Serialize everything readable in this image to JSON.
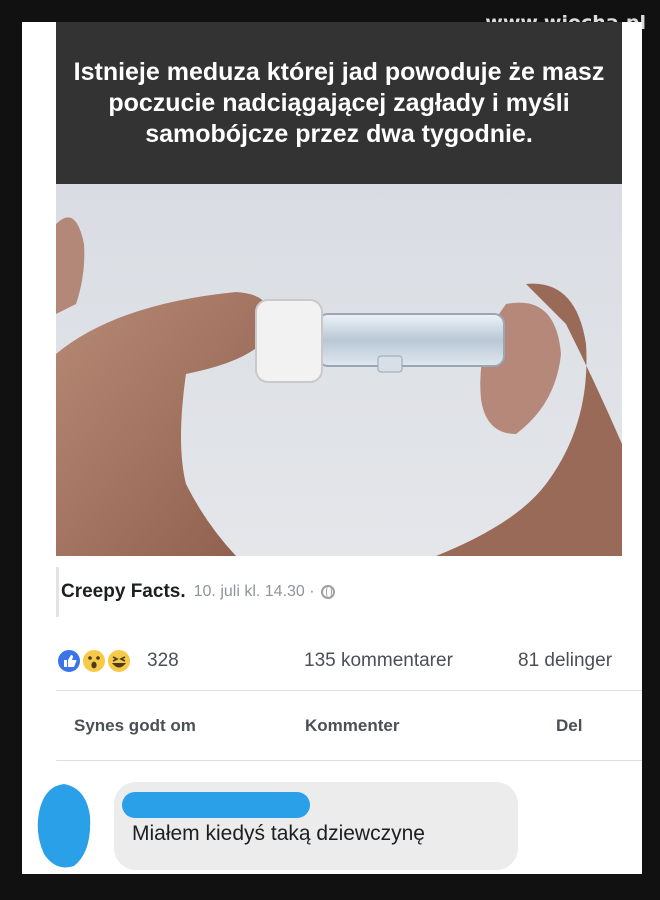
{
  "watermark": "www.wiocha.pl",
  "caption": "Istnieje meduza której jad powoduje że masz poczucie nadciągającej zagłady i myśli samobójcze przez dwa tygodnie.",
  "post": {
    "page_name": "Creepy Facts.",
    "timestamp": "10. juli kl. 14.30 ·",
    "reaction_count": "328",
    "comment_count": "135 kommentarer",
    "share_count": "81 delinger",
    "reactions": [
      "like-icon",
      "wow-icon",
      "haha-icon"
    ]
  },
  "actions": {
    "like": "Synes godt om",
    "comment": "Kommenter",
    "share": "Del"
  },
  "comment": {
    "text": "Miałem kiedyś taką dziewczynę"
  },
  "colors": {
    "caption_bg": "#333333",
    "name_redaction": "#2aa0e8",
    "like_blue": "#3b74e8",
    "reaction_yellow": "#f7c948"
  }
}
